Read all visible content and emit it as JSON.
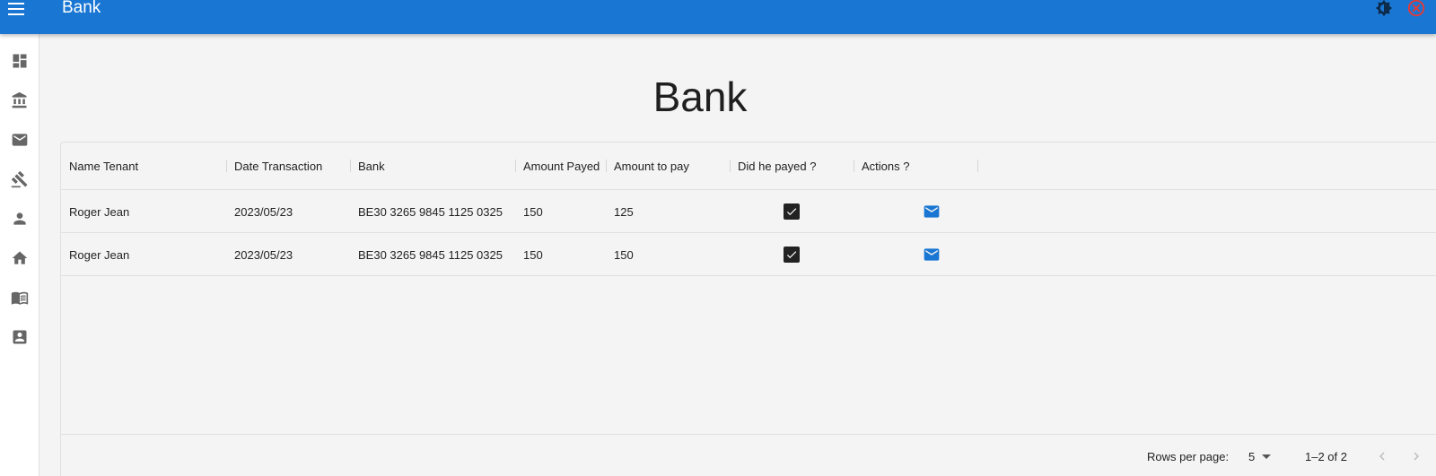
{
  "appbar": {
    "title": "Bank",
    "icons": {
      "menu": "menu-icon",
      "theme": "brightness-icon",
      "logout": "power-icon"
    },
    "colors": {
      "background": "#1976d2",
      "logout": "#e53935"
    }
  },
  "sidebar": {
    "items": [
      {
        "name": "dashboard",
        "icon": "dashboard-icon"
      },
      {
        "name": "bank",
        "icon": "bank-icon"
      },
      {
        "name": "mail",
        "icon": "mail-icon"
      },
      {
        "name": "gavel",
        "icon": "gavel-icon"
      },
      {
        "name": "person",
        "icon": "person-icon"
      },
      {
        "name": "home",
        "icon": "home-icon"
      },
      {
        "name": "book",
        "icon": "menu-book-icon"
      },
      {
        "name": "contact",
        "icon": "contact-icon"
      }
    ]
  },
  "page": {
    "title": "Bank"
  },
  "table": {
    "columns": [
      "Name Tenant",
      "Date Transaction",
      "Bank",
      "Amount Payed",
      "Amount to pay",
      "Did he payed ?",
      "Actions ?"
    ],
    "rows": [
      {
        "name": "Roger Jean",
        "date": "2023/05/23",
        "bank": "BE30 3265 9845 1125 0325",
        "payed": "150",
        "to_pay": "125",
        "did_pay": true,
        "action_icon": "mail-icon"
      },
      {
        "name": "Roger Jean",
        "date": "2023/05/23",
        "bank": "BE30 3265 9845 1125 0325",
        "payed": "150",
        "to_pay": "150",
        "did_pay": true,
        "action_icon": "mail-icon"
      }
    ]
  },
  "pagination": {
    "rows_per_page_label": "Rows per page:",
    "rows_per_page": "5",
    "range": "1–2 of 2",
    "icons": {
      "prev": "chevron-left-icon",
      "next": "chevron-right-icon"
    }
  },
  "colors": {
    "accent": "#1976d2",
    "checkbox": "#222222"
  }
}
